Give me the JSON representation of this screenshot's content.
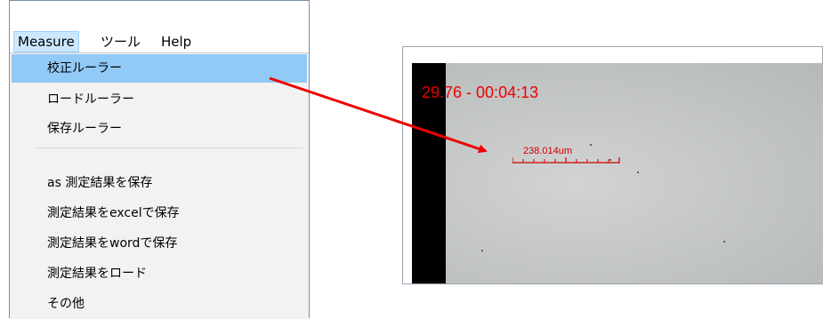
{
  "menubar": {
    "items": [
      {
        "label": "Measure",
        "active": true
      },
      {
        "label": "ツール",
        "active": false
      },
      {
        "label": "Help",
        "active": false
      }
    ]
  },
  "dropdown": {
    "items": [
      {
        "label": "校正ルーラー",
        "highlighted": true
      },
      {
        "label": "ロードルーラー",
        "highlighted": false
      },
      {
        "label": "保存ルーラー",
        "highlighted": false
      },
      {
        "label": "as 測定結果を保存",
        "highlighted": false
      },
      {
        "label": "測定結果をexcelで保存",
        "highlighted": false
      },
      {
        "label": "測定結果をwordで保存",
        "highlighted": false
      },
      {
        "label": "測定結果をロード",
        "highlighted": false
      },
      {
        "label": "その他",
        "highlighted": false
      }
    ]
  },
  "video": {
    "timestamp": "29.76 - 00:04:13",
    "ruler_label": "238.014um"
  },
  "colors": {
    "annotation_red": "#ee0000",
    "highlight_blue": "#91c9f7"
  }
}
